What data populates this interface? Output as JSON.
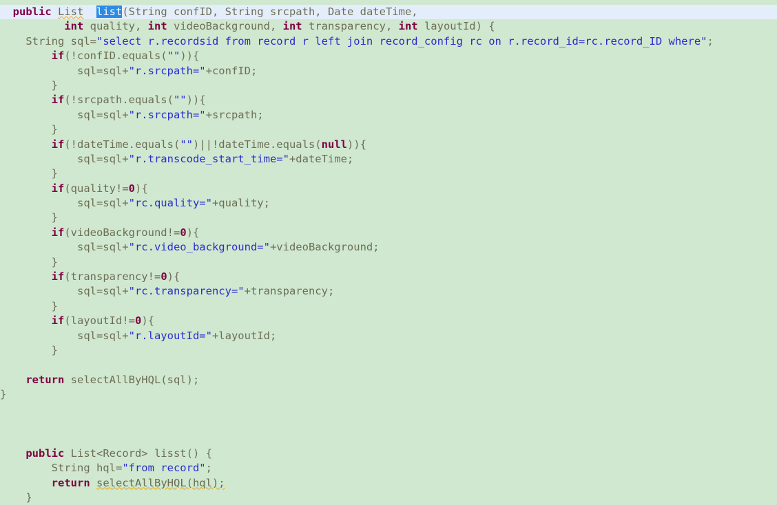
{
  "editor": {
    "background_color": "#cfe8cf",
    "current_line_highlight_color": "#e4eefb",
    "selection_color": "#2d8ae5",
    "keyword_color": "#7f0043",
    "string_color": "#2b2bd0",
    "text_color": "#6e6e56",
    "warning_underline_color": "#f0a500",
    "language": "Java"
  },
  "code": {
    "lines": [
      {
        "id": "line-1",
        "current": true,
        "tokens": [
          {
            "t": "  ",
            "c": "plain"
          },
          {
            "t": "public",
            "c": "kw"
          },
          {
            "t": " ",
            "c": "plain"
          },
          {
            "t": "List",
            "c": "warn"
          },
          {
            "t": "  ",
            "c": "plain"
          },
          {
            "t": "list",
            "c": "sel"
          },
          {
            "t": "(String confID, String srcpath, Date dateTime,",
            "c": "plain"
          }
        ]
      },
      {
        "id": "line-2",
        "current": false,
        "tokens": [
          {
            "t": "          ",
            "c": "plain"
          },
          {
            "t": "int",
            "c": "kw"
          },
          {
            "t": " quality, ",
            "c": "plain"
          },
          {
            "t": "int",
            "c": "kw"
          },
          {
            "t": " videoBackground, ",
            "c": "plain"
          },
          {
            "t": "int",
            "c": "kw"
          },
          {
            "t": " transparency, ",
            "c": "plain"
          },
          {
            "t": "int",
            "c": "kw"
          },
          {
            "t": " layoutId) {",
            "c": "plain"
          }
        ]
      },
      {
        "id": "line-3",
        "current": false,
        "tokens": [
          {
            "t": "    String sql=",
            "c": "plain"
          },
          {
            "t": "\"select r.recordsid from record r left join record_config rc on r.record_id=rc.record_ID where\"",
            "c": "str"
          },
          {
            "t": ";",
            "c": "plain"
          }
        ]
      },
      {
        "id": "line-4",
        "current": false,
        "tokens": [
          {
            "t": "        ",
            "c": "plain"
          },
          {
            "t": "if",
            "c": "kw"
          },
          {
            "t": "(!confID.equals(",
            "c": "plain"
          },
          {
            "t": "\"\"",
            "c": "str"
          },
          {
            "t": ")){",
            "c": "plain"
          }
        ]
      },
      {
        "id": "line-5",
        "current": false,
        "tokens": [
          {
            "t": "            sql=sql+",
            "c": "plain"
          },
          {
            "t": "\"r.srcpath=\"",
            "c": "str"
          },
          {
            "t": "+confID;",
            "c": "plain"
          }
        ]
      },
      {
        "id": "line-6",
        "current": false,
        "tokens": [
          {
            "t": "        }",
            "c": "plain"
          }
        ]
      },
      {
        "id": "line-7",
        "current": false,
        "tokens": [
          {
            "t": "        ",
            "c": "plain"
          },
          {
            "t": "if",
            "c": "kw"
          },
          {
            "t": "(!srcpath.equals(",
            "c": "plain"
          },
          {
            "t": "\"\"",
            "c": "str"
          },
          {
            "t": ")){",
            "c": "plain"
          }
        ]
      },
      {
        "id": "line-8",
        "current": false,
        "tokens": [
          {
            "t": "            sql=sql+",
            "c": "plain"
          },
          {
            "t": "\"r.srcpath=\"",
            "c": "str"
          },
          {
            "t": "+srcpath;",
            "c": "plain"
          }
        ]
      },
      {
        "id": "line-9",
        "current": false,
        "tokens": [
          {
            "t": "        }",
            "c": "plain"
          }
        ]
      },
      {
        "id": "line-10",
        "current": false,
        "tokens": [
          {
            "t": "        ",
            "c": "plain"
          },
          {
            "t": "if",
            "c": "kw"
          },
          {
            "t": "(!dateTime.equals(",
            "c": "plain"
          },
          {
            "t": "\"\"",
            "c": "str"
          },
          {
            "t": ")||!dateTime.equals(",
            "c": "plain"
          },
          {
            "t": "null",
            "c": "kw"
          },
          {
            "t": ")){",
            "c": "plain"
          }
        ]
      },
      {
        "id": "line-11",
        "current": false,
        "tokens": [
          {
            "t": "            sql=sql+",
            "c": "plain"
          },
          {
            "t": "\"r.transcode_start_time=\"",
            "c": "str"
          },
          {
            "t": "+dateTime;",
            "c": "plain"
          }
        ]
      },
      {
        "id": "line-12",
        "current": false,
        "tokens": [
          {
            "t": "        }",
            "c": "plain"
          }
        ]
      },
      {
        "id": "line-13",
        "current": false,
        "tokens": [
          {
            "t": "        ",
            "c": "plain"
          },
          {
            "t": "if",
            "c": "kw"
          },
          {
            "t": "(quality!=",
            "c": "plain"
          },
          {
            "t": "0",
            "c": "kw"
          },
          {
            "t": "){",
            "c": "plain"
          }
        ]
      },
      {
        "id": "line-14",
        "current": false,
        "tokens": [
          {
            "t": "            sql=sql+",
            "c": "plain"
          },
          {
            "t": "\"rc.quality=\"",
            "c": "str"
          },
          {
            "t": "+quality;",
            "c": "plain"
          }
        ]
      },
      {
        "id": "line-15",
        "current": false,
        "tokens": [
          {
            "t": "        }",
            "c": "plain"
          }
        ]
      },
      {
        "id": "line-16",
        "current": false,
        "tokens": [
          {
            "t": "        ",
            "c": "plain"
          },
          {
            "t": "if",
            "c": "kw"
          },
          {
            "t": "(videoBackground!=",
            "c": "plain"
          },
          {
            "t": "0",
            "c": "kw"
          },
          {
            "t": "){",
            "c": "plain"
          }
        ]
      },
      {
        "id": "line-17",
        "current": false,
        "tokens": [
          {
            "t": "            sql=sql+",
            "c": "plain"
          },
          {
            "t": "\"rc.video_background=\"",
            "c": "str"
          },
          {
            "t": "+videoBackground;",
            "c": "plain"
          }
        ]
      },
      {
        "id": "line-18",
        "current": false,
        "tokens": [
          {
            "t": "        }",
            "c": "plain"
          }
        ]
      },
      {
        "id": "line-19",
        "current": false,
        "tokens": [
          {
            "t": "        ",
            "c": "plain"
          },
          {
            "t": "if",
            "c": "kw"
          },
          {
            "t": "(transparency!=",
            "c": "plain"
          },
          {
            "t": "0",
            "c": "kw"
          },
          {
            "t": "){",
            "c": "plain"
          }
        ]
      },
      {
        "id": "line-20",
        "current": false,
        "tokens": [
          {
            "t": "            sql=sql+",
            "c": "plain"
          },
          {
            "t": "\"rc.transparency=\"",
            "c": "str"
          },
          {
            "t": "+transparency;",
            "c": "plain"
          }
        ]
      },
      {
        "id": "line-21",
        "current": false,
        "tokens": [
          {
            "t": "        }",
            "c": "plain"
          }
        ]
      },
      {
        "id": "line-22",
        "current": false,
        "tokens": [
          {
            "t": "        ",
            "c": "plain"
          },
          {
            "t": "if",
            "c": "kw"
          },
          {
            "t": "(layoutId!=",
            "c": "plain"
          },
          {
            "t": "0",
            "c": "kw"
          },
          {
            "t": "){",
            "c": "plain"
          }
        ]
      },
      {
        "id": "line-23",
        "current": false,
        "tokens": [
          {
            "t": "            sql=sql+",
            "c": "plain"
          },
          {
            "t": "\"r.layoutId=\"",
            "c": "str"
          },
          {
            "t": "+layoutId;",
            "c": "plain"
          }
        ]
      },
      {
        "id": "line-24",
        "current": false,
        "tokens": [
          {
            "t": "        }",
            "c": "plain"
          }
        ]
      },
      {
        "id": "line-25",
        "current": false,
        "tokens": [
          {
            "t": "",
            "c": "plain"
          }
        ]
      },
      {
        "id": "line-26",
        "current": false,
        "tokens": [
          {
            "t": "    ",
            "c": "plain"
          },
          {
            "t": "return",
            "c": "kw"
          },
          {
            "t": " selectAllByHQL(sql);",
            "c": "plain"
          }
        ]
      },
      {
        "id": "line-27",
        "current": false,
        "tokens": [
          {
            "t": "}",
            "c": "plain"
          }
        ]
      },
      {
        "id": "line-28",
        "current": false,
        "tokens": [
          {
            "t": "",
            "c": "plain"
          }
        ]
      },
      {
        "id": "line-29",
        "current": false,
        "tokens": [
          {
            "t": "",
            "c": "plain"
          }
        ]
      },
      {
        "id": "line-30",
        "current": false,
        "tokens": [
          {
            "t": "",
            "c": "plain"
          }
        ]
      },
      {
        "id": "line-31",
        "current": false,
        "tokens": [
          {
            "t": "    ",
            "c": "plain"
          },
          {
            "t": "public",
            "c": "kw"
          },
          {
            "t": " List<Record> lisst() {",
            "c": "plain"
          }
        ]
      },
      {
        "id": "line-32",
        "current": false,
        "tokens": [
          {
            "t": "        String hql=",
            "c": "plain"
          },
          {
            "t": "\"from record\"",
            "c": "str"
          },
          {
            "t": ";",
            "c": "plain"
          }
        ]
      },
      {
        "id": "line-33",
        "current": false,
        "tokens": [
          {
            "t": "        ",
            "c": "plain"
          },
          {
            "t": "return",
            "c": "kw"
          },
          {
            "t": " ",
            "c": "plain"
          },
          {
            "t": "selectAllByHQL(hql);",
            "c": "warn"
          }
        ]
      },
      {
        "id": "line-34",
        "current": false,
        "tokens": [
          {
            "t": "    }",
            "c": "plain"
          }
        ]
      }
    ]
  }
}
